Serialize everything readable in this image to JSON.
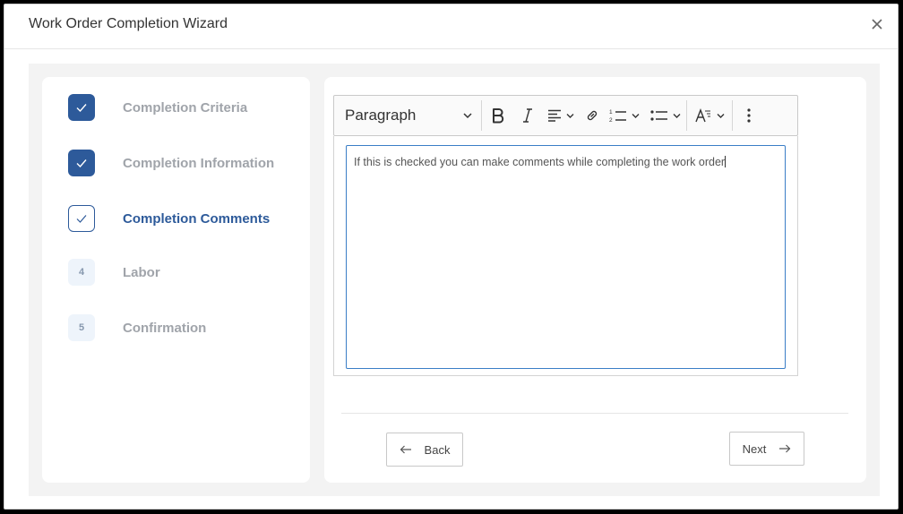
{
  "dialog": {
    "title": "Work Order Completion Wizard",
    "close_icon": "close-icon"
  },
  "steps": [
    {
      "number": "",
      "label": "Completion Criteria",
      "state": "done",
      "icon": "check-icon"
    },
    {
      "number": "",
      "label": "Completion Information",
      "state": "done",
      "icon": "check-icon"
    },
    {
      "number": "",
      "label": "Completion Comments",
      "state": "current",
      "icon": "check-icon"
    },
    {
      "number": "4",
      "label": "Labor",
      "state": "todo"
    },
    {
      "number": "5",
      "label": "Confirmation",
      "state": "todo"
    }
  ],
  "toolbar": {
    "paragraph_label": "Paragraph",
    "icons": [
      "bold-icon",
      "italic-icon",
      "align-icon",
      "link-icon",
      "numbered-list-icon",
      "bulleted-list-icon",
      "text-style-icon",
      "more-icon"
    ]
  },
  "editor": {
    "text": "If this is checked you can make comments while completing the work order"
  },
  "nav": {
    "back_label": "Back",
    "next_label": "Next"
  },
  "colors": {
    "primary": "#2d5a9a",
    "editor_focus": "#3a7ec6",
    "muted_label": "#a0a4aa"
  }
}
